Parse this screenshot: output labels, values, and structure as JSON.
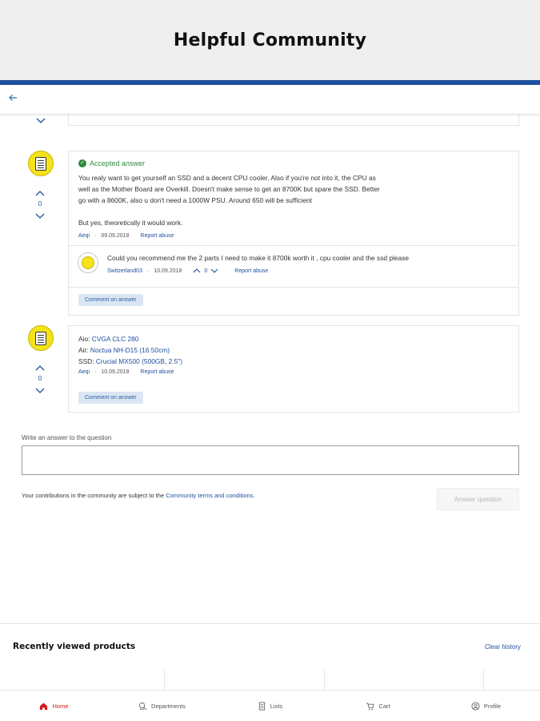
{
  "banner": {
    "title": "Helpful Community"
  },
  "answers": [
    {
      "accepted_label": "Accepted answer",
      "text": [
        "You realy want to get yourself an SSD and a decent CPU cooler. Also if you're not into it, the CPU as",
        "well as the Mother Board are Overkill. Doesn't make sense to get an 8700K but spare the SSD. Better",
        "go with a 8600K, also u don't need a 1000W PSU. Around 650 will be sufficient",
        "But yes, theoretically it would work."
      ],
      "author": "Aeqi",
      "date": "09.09.2018",
      "report": "Report abuse",
      "votes": "0",
      "comment": {
        "text": "Could you recommend me the 2 parts I need to make it 8700k worth it , cpu cooler and the ssd please",
        "author": "Switzerland03",
        "date": "10.09.2018",
        "votes": "0",
        "report": "Report abuse"
      },
      "comment_button": "Comment on answer"
    },
    {
      "lines": [
        {
          "prefix": "Aio: ",
          "link": "CVGA CLC 280"
        },
        {
          "prefix": "Air: ",
          "link": "Noctua NH-D15 (16.50cm)"
        },
        {
          "prefix": "SSD: ",
          "link": "Crucial MX500 (500GB, 2.5\")"
        }
      ],
      "author": "Aeqi",
      "date": "10.09.2018",
      "report": "Report abuse",
      "votes": "0",
      "comment_button": "Comment on answer"
    }
  ],
  "write": {
    "label": "Write an answer to the question",
    "terms_prefix": "Your contributions in the community are subject to the ",
    "terms_link": "Community terms and conditions",
    "terms_suffix": ".",
    "submit": "Answer question"
  },
  "recent": {
    "title": "Recently viewed products",
    "clear": "Clear history"
  },
  "nav": [
    {
      "label": "Home",
      "icon": "home-icon",
      "active": true
    },
    {
      "label": "Departments",
      "icon": "departments-icon",
      "active": false
    },
    {
      "label": "Lists",
      "icon": "lists-icon",
      "active": false
    },
    {
      "label": "Cart",
      "icon": "cart-icon",
      "active": false
    },
    {
      "label": "Profile",
      "icon": "profile-icon",
      "active": false
    }
  ],
  "colors": {
    "brand_blue": "#1d4f9e",
    "accepted_green": "#2f8a3c",
    "active_red": "#d21a1a",
    "avatar_yellow": "#f5e31a"
  }
}
